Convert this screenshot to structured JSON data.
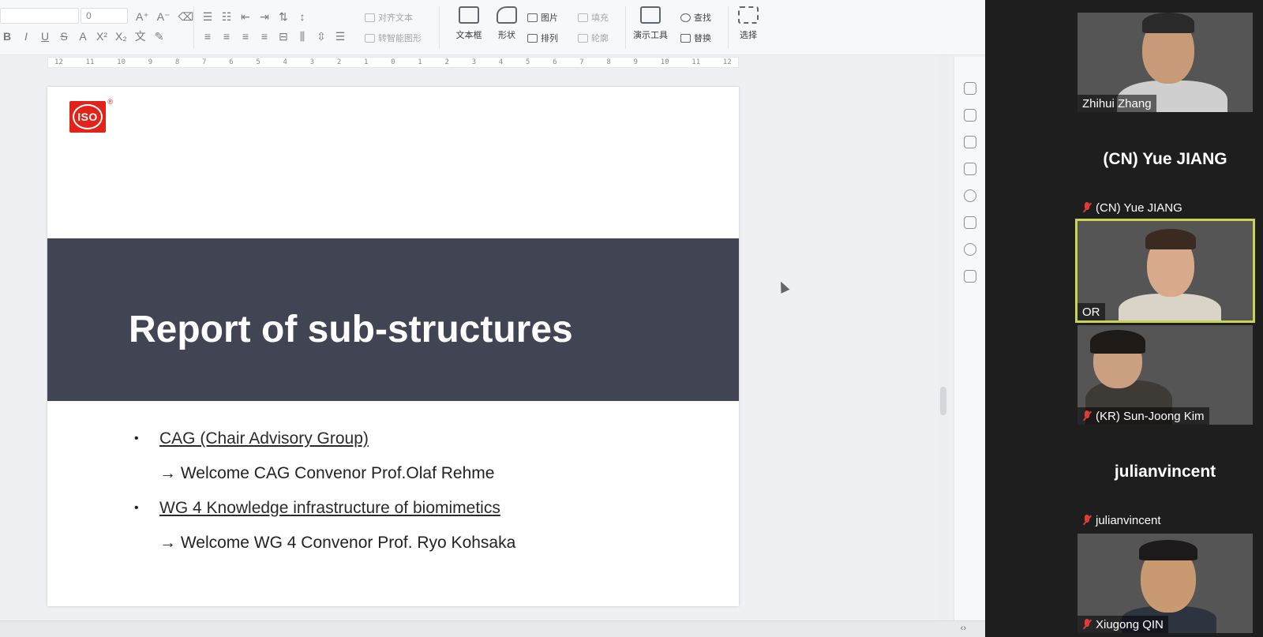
{
  "toolbar": {
    "font_name_value": "",
    "font_size_value": "0",
    "align_text_label": "对齐文本",
    "smartart_label": "转智能图形",
    "textbox_label": "文本框",
    "shape_label": "形状",
    "picture_label": "图片",
    "arrange_label": "排列",
    "fill_label": "填充",
    "outline_label": "轮廓",
    "present_tools_label": "演示工具",
    "find_label": "查找",
    "replace_label": "替换",
    "select_label": "选择",
    "ruler_numbers": [
      "12",
      "11",
      "10",
      "9",
      "8",
      "7",
      "6",
      "5",
      "4",
      "3",
      "2",
      "1",
      "0",
      "1",
      "2",
      "3",
      "4",
      "5",
      "6",
      "7",
      "8",
      "9",
      "10",
      "11",
      "12"
    ]
  },
  "slide": {
    "logo_text": "ISO",
    "logo_reg": "®",
    "title": "Report of sub-structures",
    "bullet_1": "CAG (Chair Advisory Group)",
    "sub_1": "→ Welcome CAG Convenor Prof.Olaf Rehme",
    "bullet_2": "WG 4  Knowledge infrastructure of biomimetics",
    "sub_2": "→ Welcome WG 4 Convenor Prof. Ryo Kohsaka",
    "bullet_marker": "•",
    "band_color": "#414452",
    "logo_color": "#e2231a"
  },
  "participants": [
    {
      "name": "Zhihui Zhang",
      "mode": "video",
      "muted": false
    },
    {
      "name": "(CN) Yue JIANG",
      "mode": "name",
      "display": "(CN) Yue JIANG",
      "muted": true
    },
    {
      "name": "OR",
      "mode": "video",
      "muted": false,
      "active_speaker": true
    },
    {
      "name": "(KR) Sun-Joong Kim",
      "mode": "video",
      "muted": true
    },
    {
      "name": "julianvincent",
      "mode": "name",
      "display": "julianvincent",
      "muted": true
    },
    {
      "name": "Xiugong QIN",
      "mode": "video",
      "muted": true
    }
  ],
  "colors": {
    "active_speaker_border": "#c7d64e",
    "mute_red": "#e03b3b"
  }
}
